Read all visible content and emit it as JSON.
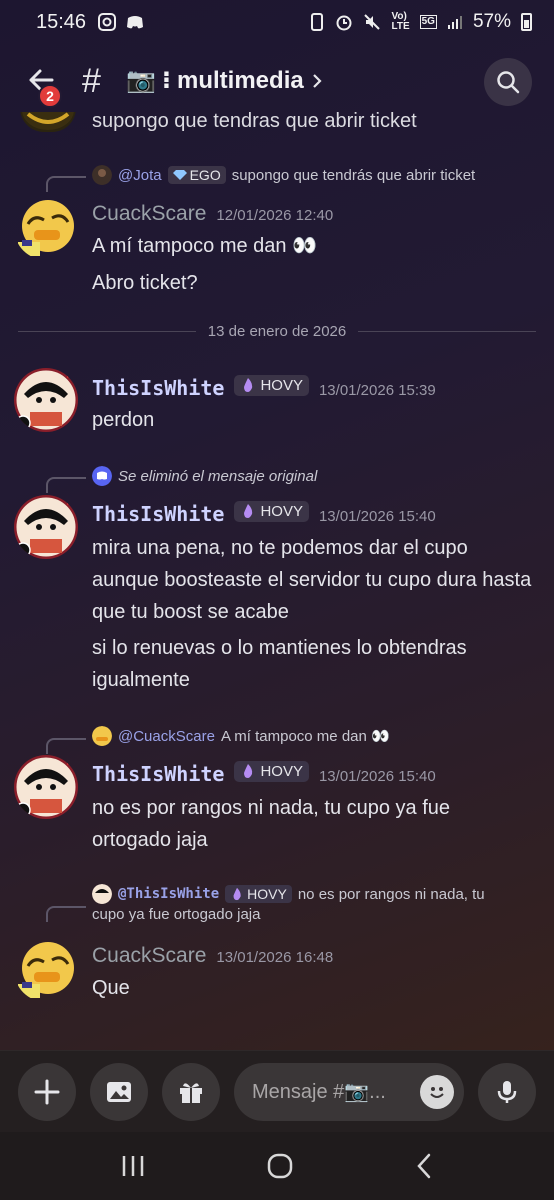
{
  "status_bar": {
    "time": "15:46",
    "battery": "57%",
    "net_top": "Vo)",
    "net_bottom": "LTE",
    "gen": "5G"
  },
  "header": {
    "badge": "2",
    "channel_name": "multimedia",
    "channel_emoji": "📷",
    "separator": "⁝"
  },
  "cutoff_message": {
    "text": "supongo que tendras que abrir ticket"
  },
  "messages": [
    {
      "reply": {
        "mention": "@Jota",
        "role": "EGO",
        "text": "supongo que tendrás que abrir ticket"
      },
      "author": "CuackScare",
      "timestamp": "12/01/2026 12:40",
      "lines": [
        "A mí tampoco me dan 👀",
        "Abro ticket?"
      ]
    },
    {
      "author": "ThisIsWhite",
      "role": "HOVY",
      "timestamp": "13/01/2026 15:39",
      "lines": [
        "perdon"
      ]
    },
    {
      "reply": {
        "text": "Se eliminó el mensaje original"
      },
      "author": "ThisIsWhite",
      "role": "HOVY",
      "timestamp": "13/01/2026 15:40",
      "lines": [
        "mira una pena, no te podemos dar el cupo aunque boosteaste el servidor tu cupo dura hasta que tu boost se acabe",
        "si lo renuevas o lo mantienes lo obtendras igualmente"
      ]
    },
    {
      "reply": {
        "mention": "@CuackScare",
        "text": "A mí tampoco me dan 👀"
      },
      "author": "ThisIsWhite",
      "role": "HOVY",
      "timestamp": "13/01/2026 15:40",
      "lines": [
        "no es por rangos ni nada, tu cupo ya fue ortogado jaja"
      ]
    },
    {
      "reply": {
        "mention": "@ThisIsWhite",
        "role": "HOVY",
        "text": "no es por rangos ni nada, tu",
        "text2": "cupo ya fue ortogado jaja"
      },
      "author": "CuackScare",
      "timestamp": "13/01/2026 16:48",
      "lines": [
        "Que"
      ]
    }
  ],
  "date_divider": "13 de enero de 2026",
  "composer": {
    "placeholder": "Mensaje #📷..."
  },
  "colors": {
    "accent_badge": "#e23b3b",
    "mention": "#9aa2e8",
    "name_white": "#cfd3ff",
    "name_cuack": "#9aa1a8"
  }
}
